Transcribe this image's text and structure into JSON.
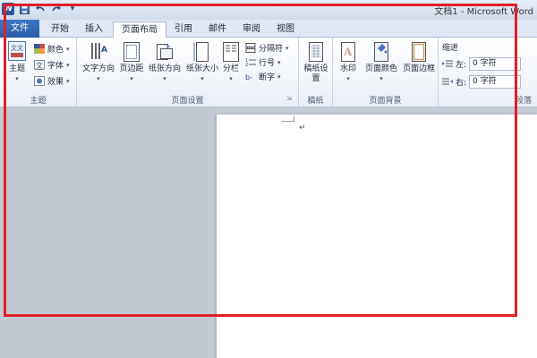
{
  "window": {
    "title": "文档1 - Microsoft Word"
  },
  "quick_access": {
    "logo": "W",
    "save_icon": "save-icon",
    "undo_icon": "undo-icon",
    "redo_icon": "redo-icon"
  },
  "tabs": [
    "文件",
    "开始",
    "插入",
    "页面布局",
    "引用",
    "邮件",
    "审阅",
    "视图"
  ],
  "active_tab": "页面布局",
  "ribbon": {
    "theme_group": {
      "label": "主题",
      "theme_btn": "主题",
      "colors": "颜色",
      "fonts": "字体",
      "effects": "效果"
    },
    "page_setup_group": {
      "label": "页面设置",
      "text_direction": "文字方向",
      "margins": "页边距",
      "orientation": "纸张方向",
      "size": "纸张大小",
      "columns": "分栏",
      "breaks": "分隔符",
      "line_numbers": "行号",
      "hyphenation": "断字"
    },
    "draft_group": {
      "label": "稿纸",
      "draft_settings": "稿纸设置"
    },
    "background_group": {
      "label": "页面背景",
      "watermark": "水印",
      "page_color": "页面颜色",
      "page_borders": "页面边框"
    },
    "paragraph_group": {
      "label": "段落",
      "indent_title": "缩进",
      "left_label": "左:",
      "left_value": "0 字符",
      "right_label": "右:",
      "right_value": "0 字符"
    }
  },
  "document": {
    "paragraph_mark": "↵"
  },
  "highlight_color": "#e01f26"
}
